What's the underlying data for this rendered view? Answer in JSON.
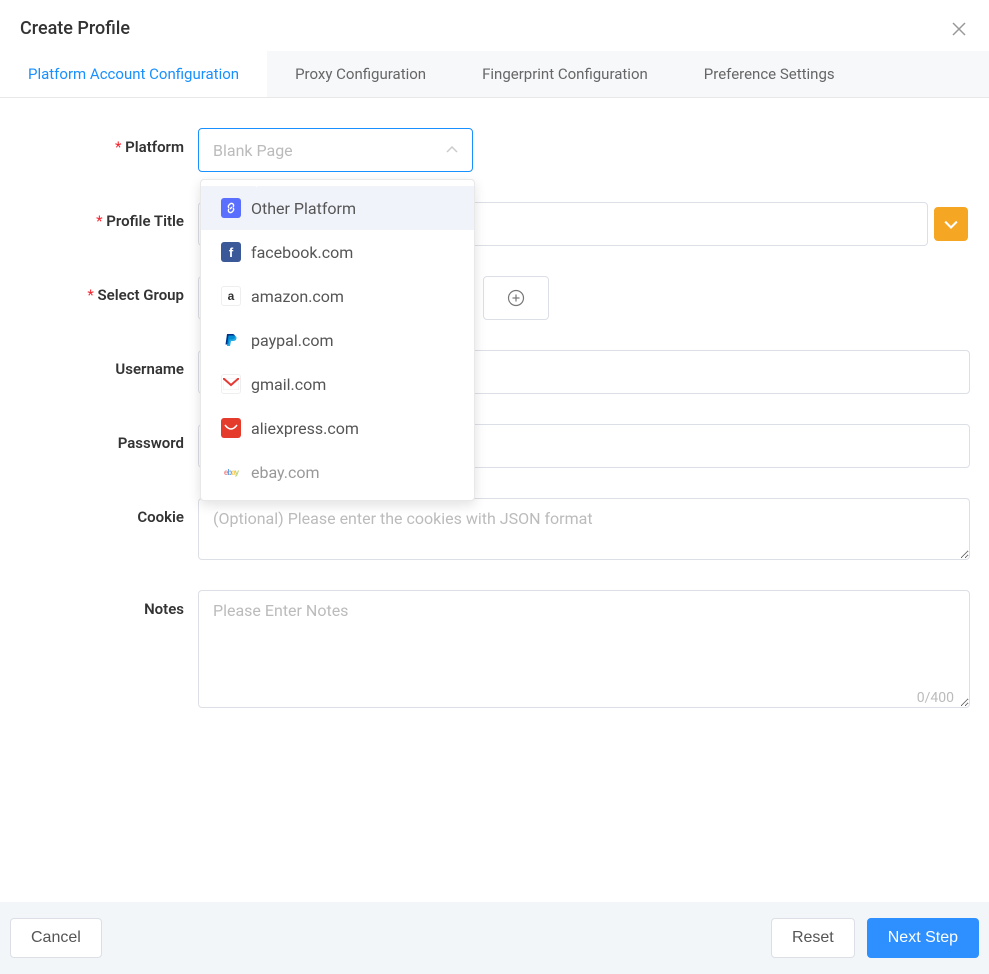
{
  "header": {
    "title": "Create Profile"
  },
  "tabs": [
    {
      "label": "Platform Account Configuration",
      "active": true
    },
    {
      "label": "Proxy Configuration",
      "active": false
    },
    {
      "label": "Fingerprint Configuration",
      "active": false
    },
    {
      "label": "Preference Settings",
      "active": false
    }
  ],
  "form": {
    "platform": {
      "label": "Platform",
      "placeholder": "Blank Page",
      "options": [
        {
          "label": "Other Platform",
          "icon": "other"
        },
        {
          "label": "facebook.com",
          "icon": "fb"
        },
        {
          "label": "amazon.com",
          "icon": "amazon"
        },
        {
          "label": "paypal.com",
          "icon": "paypal"
        },
        {
          "label": "gmail.com",
          "icon": "gmail"
        },
        {
          "label": "aliexpress.com",
          "icon": "ali"
        },
        {
          "label": "ebay.com",
          "icon": "ebay"
        }
      ]
    },
    "profileTitle": {
      "label": "Profile Title",
      "placeholder": ""
    },
    "selectGroup": {
      "label": "Select Group",
      "placeholder": ""
    },
    "username": {
      "label": "Username",
      "placeholder": ""
    },
    "password": {
      "label": "Password",
      "placeholder": ""
    },
    "cookie": {
      "label": "Cookie",
      "placeholder": "(Optional) Please enter the cookies with JSON format"
    },
    "notes": {
      "label": "Notes",
      "placeholder": "Please Enter Notes",
      "counter": "0/400"
    }
  },
  "footer": {
    "cancel": "Cancel",
    "reset": "Reset",
    "next": "Next Step"
  }
}
